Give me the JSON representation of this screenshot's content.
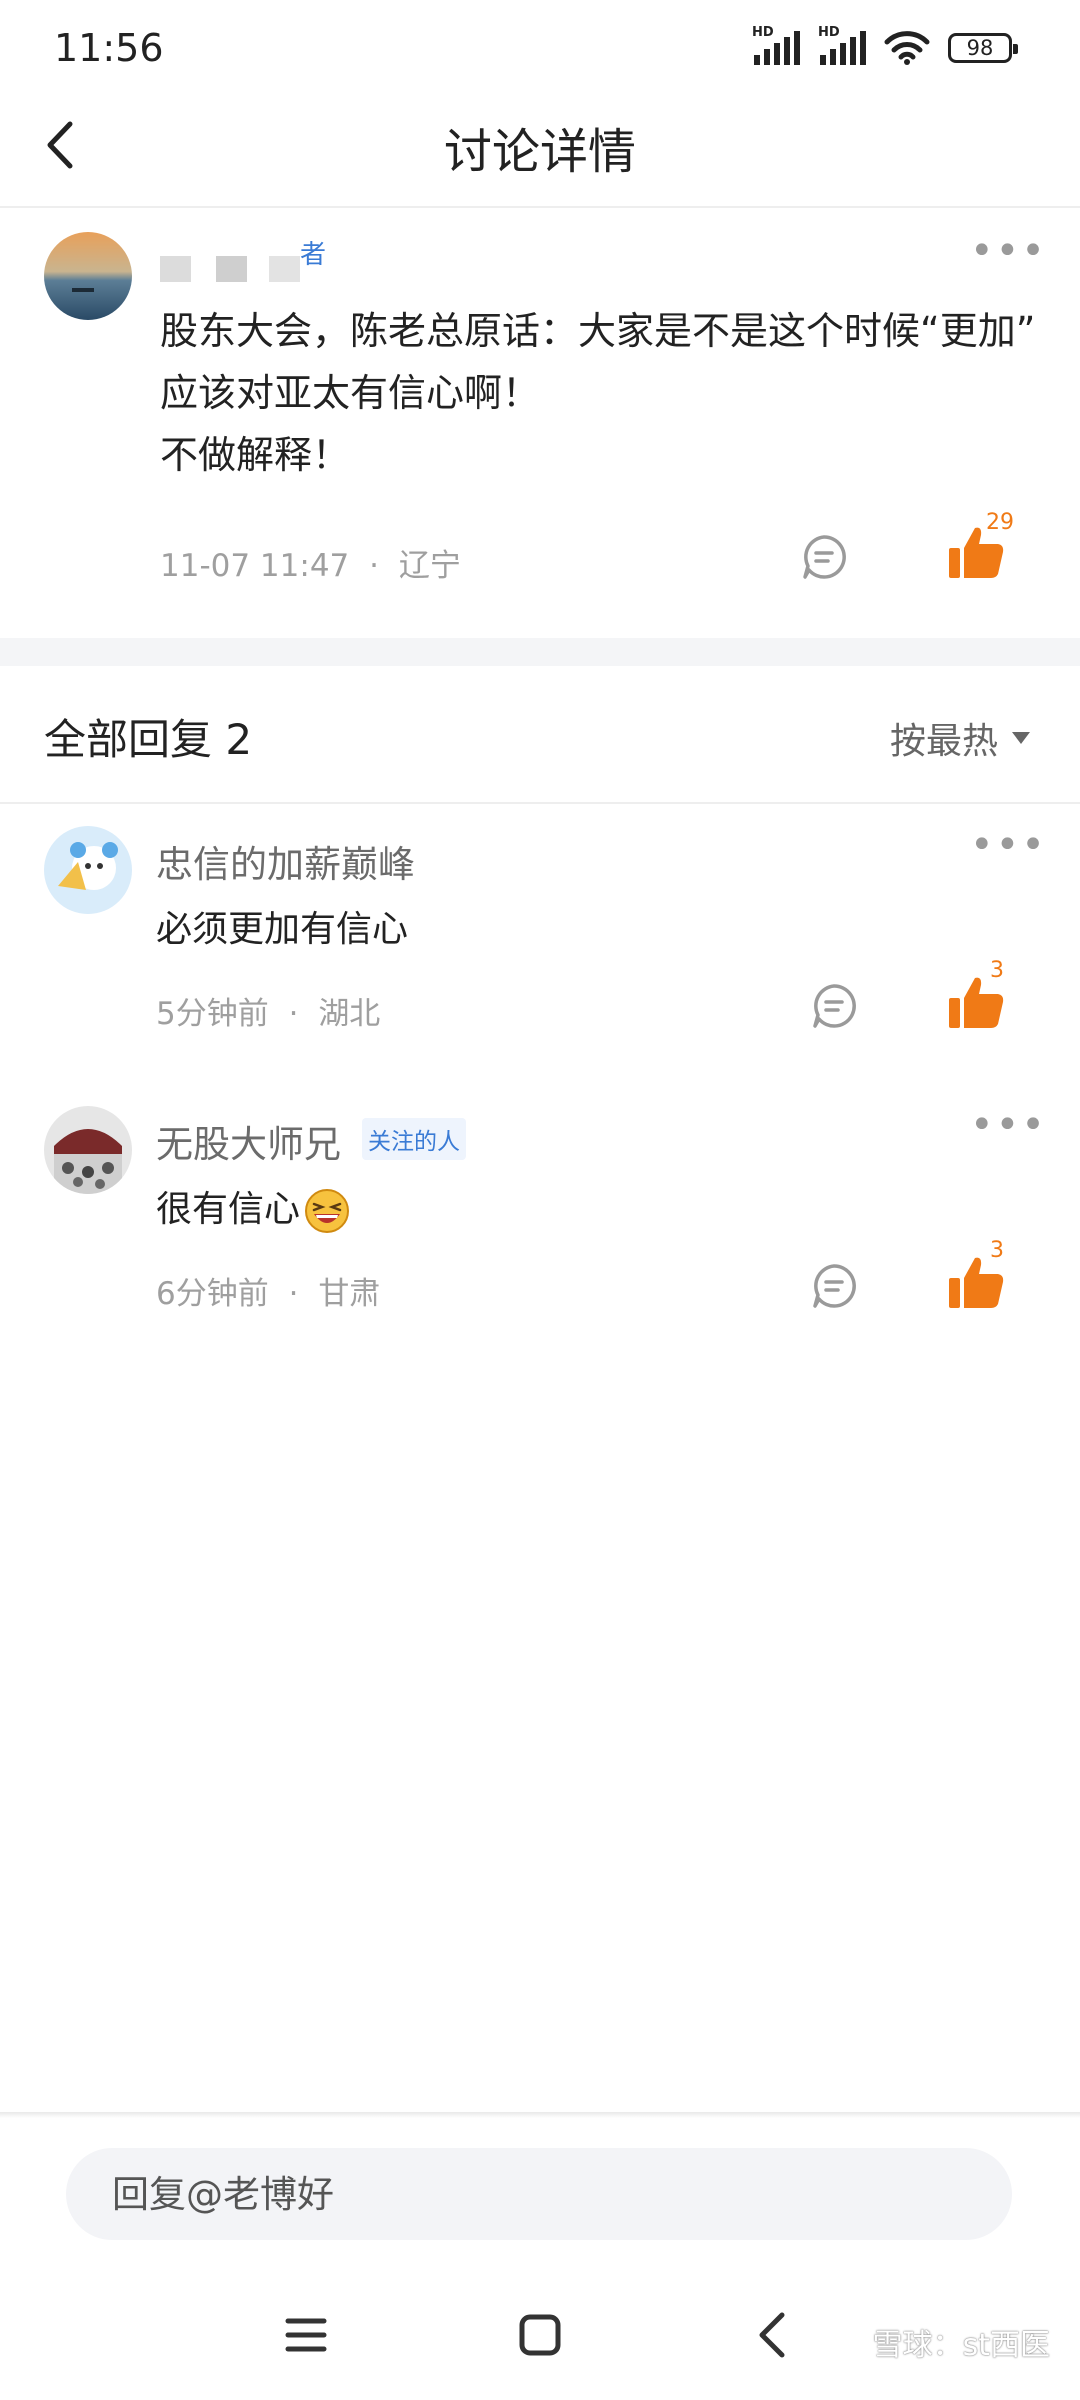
{
  "status_bar": {
    "time": "11:56",
    "network_1": "HD",
    "network_2": "HD",
    "battery": "98"
  },
  "header": {
    "title": "讨论详情"
  },
  "post": {
    "author_tag": "者",
    "lines": [
      "股东大会，陈老总原话：大家是不是这个时候“更加”",
      "应该对亚太有信心啊！",
      "不做解释！"
    ],
    "time": "11-07 11:47",
    "separator": "·",
    "location": "辽宁",
    "like_count": "29"
  },
  "replies": {
    "title": "全部回复 2",
    "sort_label": "按最热",
    "items": [
      {
        "name": "忠信的加薪巅峰",
        "tag": "",
        "text": "必须更加有信心",
        "time": "5分钟前",
        "separator": "·",
        "location": "湖北",
        "like_count": "3"
      },
      {
        "name": "无股大师兄",
        "tag": "关注的人",
        "text": "很有信心",
        "emoji": "laughing-emoji",
        "time": "6分钟前",
        "separator": "·",
        "location": "甘肃",
        "like_count": "3"
      }
    ]
  },
  "reply_box": {
    "placeholder": "回复@老博好"
  },
  "watermark": "雪球：st西医",
  "colors": {
    "like": "#f07a16",
    "tag_blue": "#3a7bd5",
    "meta_gray": "#9f9f9f",
    "background": "#ffffff"
  },
  "icons": [
    "back-chevron-icon",
    "more-dots-icon",
    "comment-icon",
    "thumbs-up-icon",
    "sort-caret-icon",
    "menu-icon",
    "home-square-icon",
    "back-nav-icon",
    "wifi-icon",
    "signal-icon"
  ]
}
